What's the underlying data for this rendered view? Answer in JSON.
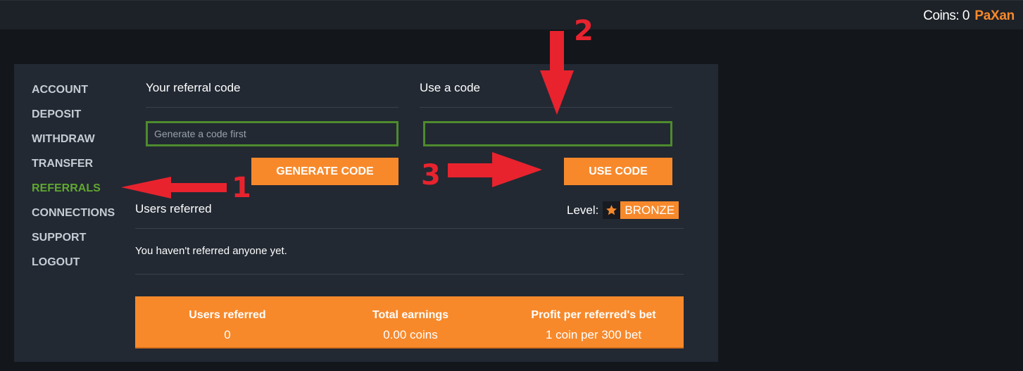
{
  "topbar": {
    "coins_text": "Coins: 0",
    "username": "PaXan"
  },
  "sidebar": {
    "items": [
      {
        "label": "ACCOUNT",
        "active": false
      },
      {
        "label": "DEPOSIT",
        "active": false
      },
      {
        "label": "WITHDRAW",
        "active": false
      },
      {
        "label": "TRANSFER",
        "active": false
      },
      {
        "label": "REFERRALS",
        "active": true
      },
      {
        "label": "CONNECTIONS",
        "active": false
      },
      {
        "label": "SUPPORT",
        "active": false
      },
      {
        "label": "LOGOUT",
        "active": false
      }
    ]
  },
  "referral": {
    "title": "Your referral code",
    "input_placeholder": "Generate a code first",
    "input_value": "",
    "button_label": "GENERATE CODE"
  },
  "use_code": {
    "title": "Use a code",
    "input_placeholder": "",
    "input_value": "",
    "button_label": "USE CODE"
  },
  "users_referred": {
    "title": "Users referred",
    "level_label": "Level:",
    "level_icon": "star-icon",
    "level_value": "BRONZE",
    "empty_message": "You haven't referred anyone yet."
  },
  "stats": [
    {
      "label": "Users referred",
      "value": "0"
    },
    {
      "label": "Total earnings",
      "value": "0.00 coins"
    },
    {
      "label": "Profit per referred's bet",
      "value": "1 coin per 300 bet"
    }
  ],
  "annotations": {
    "num1": "1",
    "num2": "2",
    "num3": "3"
  },
  "colors": {
    "accent": "#f7892b",
    "active_nav": "#62a730",
    "input_border": "#4e8b2d",
    "annotation": "#e8232e"
  }
}
